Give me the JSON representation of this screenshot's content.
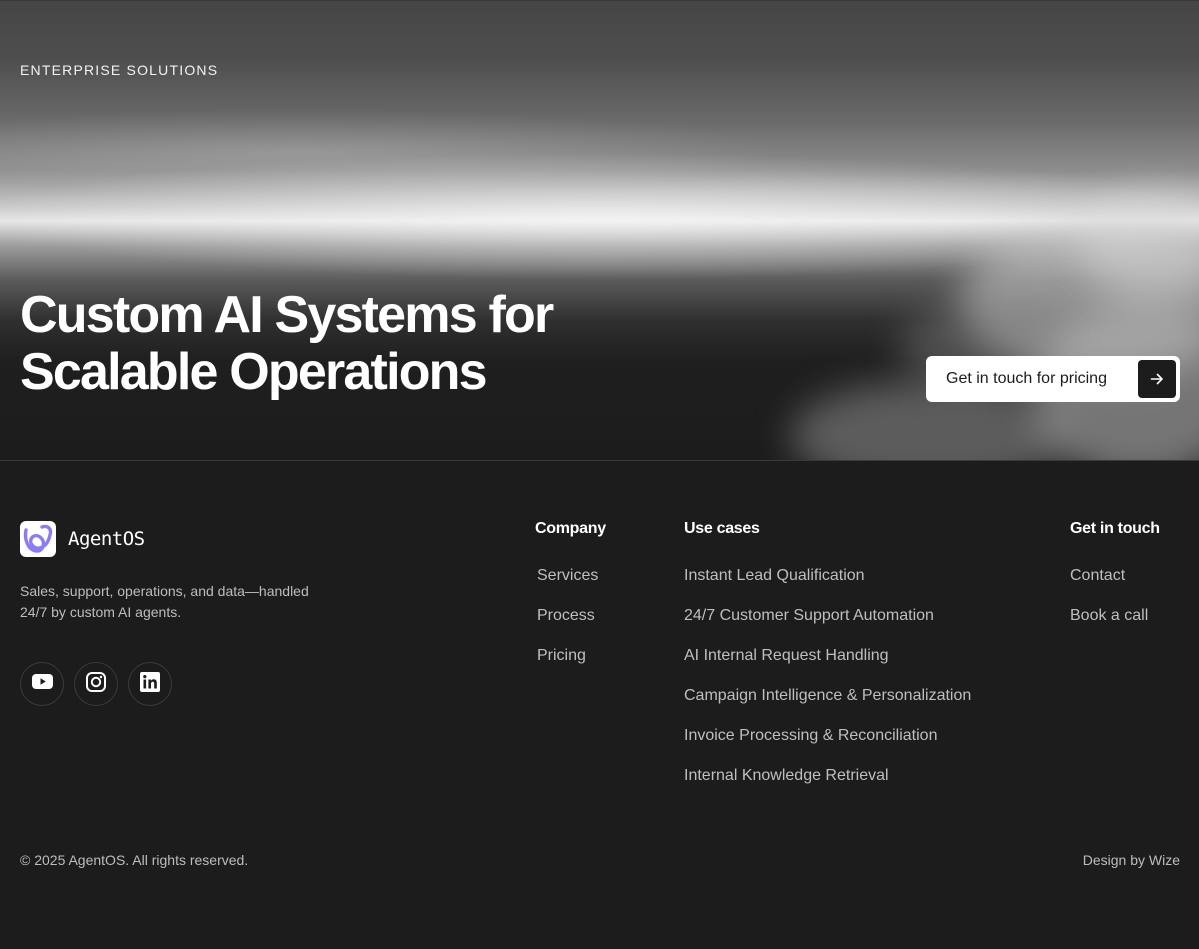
{
  "hero": {
    "eyebrow": "ENTERPRISE SOLUTIONS",
    "title_line1": "Custom AI Systems for",
    "title_line2": "Scalable Operations",
    "cta_label": "Get in touch for pricing",
    "cta_icon": "arrow-right-icon"
  },
  "footer": {
    "brand": {
      "name": "AgentOS",
      "tagline_line1": "Sales, support, operations, and data—handled",
      "tagline_line2": "24/7 by custom AI agents.",
      "logo_accent": "#8b7cf6"
    },
    "socials": [
      {
        "icon": "youtube-icon"
      },
      {
        "icon": "instagram-icon"
      },
      {
        "icon": "linkedin-icon"
      }
    ],
    "company": {
      "heading": "Company",
      "links": [
        "Services",
        "Process",
        "Pricing"
      ]
    },
    "use_cases": {
      "heading": "Use cases",
      "links": [
        "Instant Lead Qualification",
        "24/7 Customer Support Automation",
        "AI Internal Request Handling",
        "Campaign Intelligence & Personalization",
        "Invoice Processing & Reconciliation",
        "Internal Knowledge Retrieval"
      ]
    },
    "contact": {
      "heading": "Get in touch",
      "links": [
        "Contact",
        "Book a call"
      ]
    },
    "copyright": "© 2025 AgentOS. All rights reserved.",
    "credit": "Design by Wize"
  },
  "colors": {
    "background": "#1c1c1c",
    "text_primary": "#ffffff",
    "text_muted": "#bfbfbf",
    "button_bg": "#ffffff"
  }
}
